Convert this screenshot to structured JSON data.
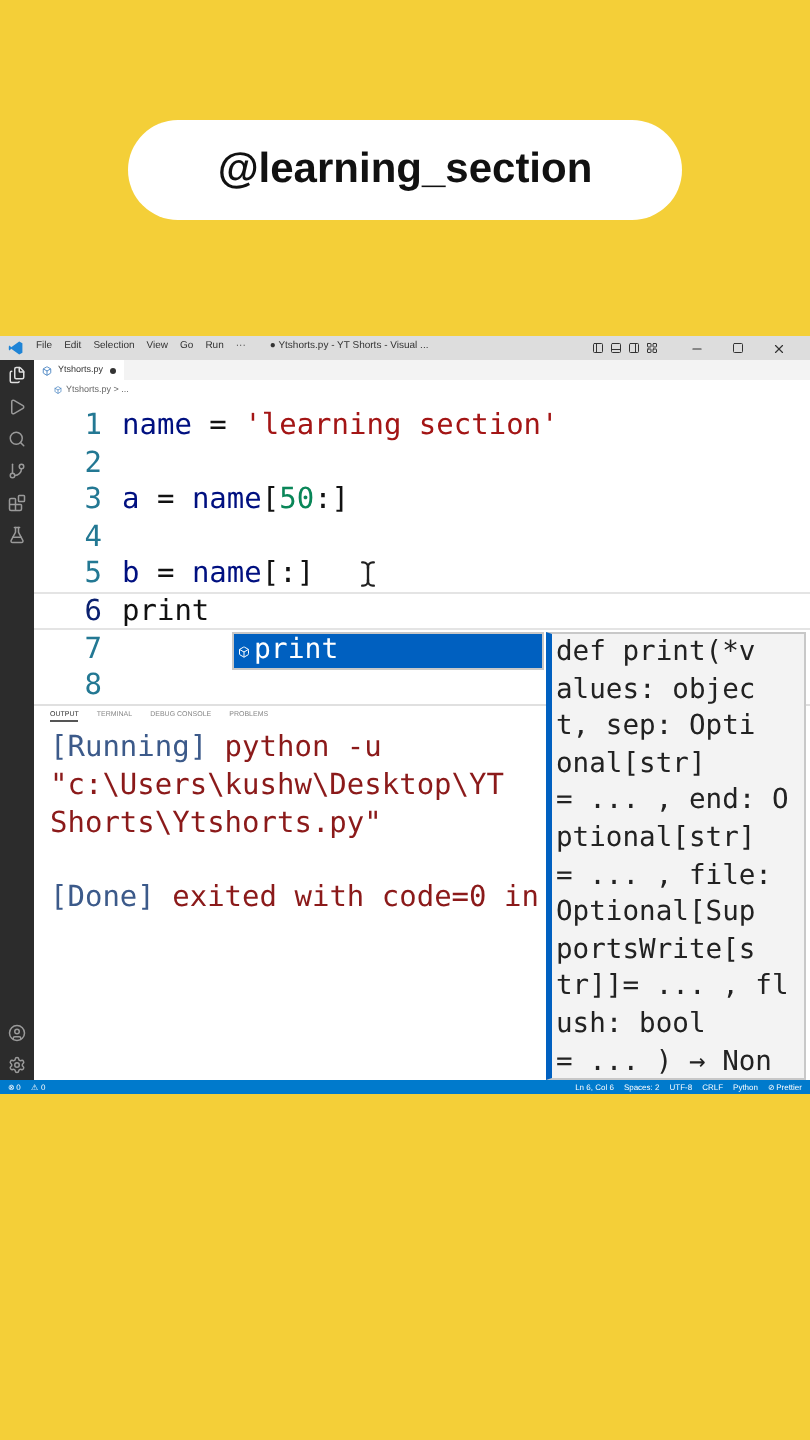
{
  "header": {
    "handle": "@learning_section"
  },
  "window": {
    "menu": [
      "File",
      "Edit",
      "Selection",
      "View",
      "Go",
      "Run",
      "···"
    ],
    "title": "● Ytshorts.py - YT Shorts - Visual ..."
  },
  "tab": {
    "label": "Ytshorts.py",
    "modified": true
  },
  "breadcrumb": "Ytshorts.py > ...",
  "code": [
    {
      "number": "1",
      "current": false,
      "tokens": [
        {
          "kind": "var",
          "text": "name"
        },
        {
          "kind": "op",
          "text": " = "
        },
        {
          "kind": "str",
          "text": "'learning section'"
        }
      ]
    },
    {
      "number": "2",
      "current": false
    },
    {
      "number": "3",
      "current": false,
      "tokens": [
        {
          "kind": "var",
          "text": "a"
        },
        {
          "kind": "op",
          "text": " = "
        },
        {
          "kind": "var",
          "text": "name"
        },
        {
          "kind": "op",
          "text": "["
        },
        {
          "kind": "num",
          "text": "50"
        },
        {
          "kind": "op",
          "text": ":]"
        }
      ]
    },
    {
      "number": "4",
      "current": false
    },
    {
      "number": "5",
      "current": false,
      "tokens": [
        {
          "kind": "var",
          "text": "b"
        },
        {
          "kind": "op",
          "text": " = "
        },
        {
          "kind": "var",
          "text": "name"
        },
        {
          "kind": "op",
          "text": "[:]"
        }
      ]
    },
    {
      "number": "6",
      "current": true,
      "tokens": [
        {
          "kind": "op",
          "text": "print"
        }
      ]
    },
    {
      "number": "7",
      "current": false
    },
    {
      "number": "8",
      "current": false
    }
  ],
  "suggest": {
    "items": [
      {
        "label": "print",
        "selected": true
      }
    ]
  },
  "doc": {
    "lines": [
      "def print(*v",
      "alues: objec",
      "t, sep: Opti",
      "onal[str]",
      "= ... , end: O",
      "ptional[str]",
      "= ... , file:",
      "Optional[Sup",
      "portsWrite[s",
      "tr]]= ... , fl",
      "ush: bool",
      "= ... ) → Non"
    ]
  },
  "panel": {
    "tabs": [
      {
        "label": "OUTPUT",
        "selected": true
      },
      {
        "label": "TERMINAL",
        "selected": false
      },
      {
        "label": "DEBUG CONSOLE",
        "selected": false
      },
      {
        "label": "PROBLEMS",
        "selected": false
      }
    ],
    "blocks": [
      {
        "lines": [
          {
            "tokens": [
              {
                "kind": "tag",
                "text": "[Running]"
              },
              {
                "kind": "msg",
                "text": " python -u"
              }
            ]
          },
          {
            "tokens": [
              {
                "kind": "msg",
                "text": "\"c:\\Users\\kushw\\Desktop\\YT"
              }
            ]
          },
          {
            "tokens": [
              {
                "kind": "msg",
                "text": "Shorts\\Ytshorts.py\""
              }
            ]
          }
        ]
      },
      {
        "lines": [
          {
            "tokens": [
              {
                "kind": "tag",
                "text": "[Done]"
              },
              {
                "kind": "msg",
                "text": " exited with code=0 in"
              }
            ]
          }
        ]
      }
    ]
  },
  "status": {
    "left": [
      "⊗ 0",
      "⚠ 0"
    ],
    "right": [
      "Ln 6, Col 6",
      "Spaces: 2",
      "UTF-8",
      "CRLF",
      "Python",
      "⊘ Prettier"
    ]
  }
}
